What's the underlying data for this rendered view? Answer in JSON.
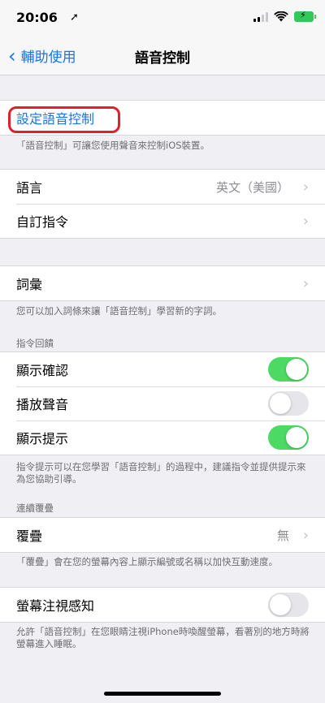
{
  "status": {
    "time": "20:06"
  },
  "nav": {
    "back_label": "輔助使用",
    "title": "語音控制"
  },
  "setup": {
    "label": "設定語音控制",
    "note": "「語音控制」可讓您使用聲音來控制iOS裝置。"
  },
  "language": {
    "label": "語言",
    "value": "英文（美國）"
  },
  "custom_commands": {
    "label": "自訂指令"
  },
  "vocabulary": {
    "label": "詞彙",
    "note": "您可以加入詞條來讓「語音控制」學習新的字詞。"
  },
  "command_feedback": {
    "header": "指令回饋",
    "items": [
      {
        "label": "顯示確認",
        "on": true
      },
      {
        "label": "播放聲音",
        "on": false
      },
      {
        "label": "顯示提示",
        "on": true
      }
    ],
    "note": "指令提示可以在您學習「語音控制」的過程中，建議指令並提供提示來為您協助引導。"
  },
  "continuous_overlay": {
    "header": "連續覆疊",
    "label": "覆疊",
    "value": "無",
    "note": "「覆疊」會在您的螢幕內容上顯示編號或名稱以加快互動速度。"
  },
  "attention": {
    "label": "螢幕注視感知",
    "on": false,
    "note": "允許「語音控制」在您眼睛注視iPhone時喚醒螢幕，看著別的地方時將螢幕進入睡眠。"
  },
  "colors": {
    "accent": "#1a73e8",
    "toggle_on": "#4cd964",
    "highlight": "#e0202a"
  }
}
